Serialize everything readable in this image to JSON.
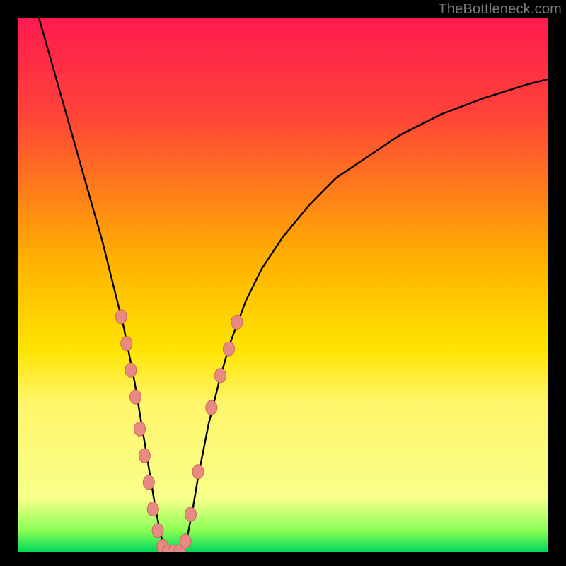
{
  "watermark": "TheBottleneck.com",
  "chart_data": {
    "type": "line",
    "title": "",
    "xlabel": "",
    "ylabel": "",
    "xlim": [
      0,
      100
    ],
    "ylim": [
      0,
      100
    ],
    "gradient_stops": [
      {
        "y": 0,
        "color": "#ff1a4f"
      },
      {
        "y": 18,
        "color": "#ff4338"
      },
      {
        "y": 45,
        "color": "#ffb000"
      },
      {
        "y": 62,
        "color": "#ffe400"
      },
      {
        "y": 72,
        "color": "#fff56a"
      },
      {
        "y": 90,
        "color": "#f7ff8a"
      },
      {
        "y": 96,
        "color": "#8aff55"
      },
      {
        "y": 100,
        "color": "#00d85a"
      }
    ],
    "series": [
      {
        "name": "bottleneck-curve",
        "x": [
          4,
          6,
          8,
          10,
          12,
          14,
          16,
          18,
          20,
          21,
          22,
          23,
          24,
          25,
          26,
          27,
          28,
          29,
          30,
          31,
          32,
          33,
          34,
          36,
          38,
          40,
          43,
          46,
          50,
          55,
          60,
          66,
          72,
          80,
          88,
          96,
          100
        ],
        "y": [
          100,
          93,
          86,
          79,
          72,
          65,
          58,
          50,
          42,
          37,
          32,
          26,
          20,
          14,
          8,
          3,
          0,
          0,
          0,
          0,
          3,
          8,
          14,
          24,
          32,
          39,
          47,
          53,
          59,
          65,
          70,
          74,
          78,
          82,
          85,
          87.5,
          88.5
        ]
      }
    ],
    "markers": {
      "name": "dot-cluster",
      "color": "#e98a82",
      "radius": 8,
      "points": [
        {
          "x": 19.5,
          "y": 44
        },
        {
          "x": 20.5,
          "y": 39
        },
        {
          "x": 21.3,
          "y": 34
        },
        {
          "x": 22.2,
          "y": 29
        },
        {
          "x": 23.0,
          "y": 23
        },
        {
          "x": 23.9,
          "y": 18
        },
        {
          "x": 24.7,
          "y": 13
        },
        {
          "x": 25.5,
          "y": 8
        },
        {
          "x": 26.4,
          "y": 4
        },
        {
          "x": 27.3,
          "y": 1
        },
        {
          "x": 28.3,
          "y": 0
        },
        {
          "x": 29.4,
          "y": 0
        },
        {
          "x": 30.5,
          "y": 0
        },
        {
          "x": 31.6,
          "y": 2
        },
        {
          "x": 32.6,
          "y": 7
        },
        {
          "x": 34.0,
          "y": 15
        },
        {
          "x": 36.5,
          "y": 27
        },
        {
          "x": 38.2,
          "y": 33
        },
        {
          "x": 39.8,
          "y": 38
        },
        {
          "x": 41.3,
          "y": 43
        }
      ]
    }
  }
}
